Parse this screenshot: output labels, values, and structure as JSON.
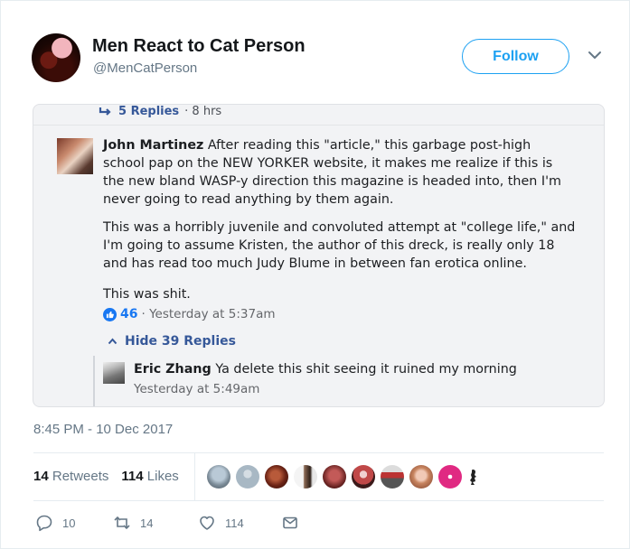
{
  "tweet": {
    "display_name": "Men React to Cat Person",
    "handle": "@MenCatPerson",
    "follow_label": "Follow",
    "timestamp": "8:45 PM - 10 Dec 2017"
  },
  "embedded": {
    "replies_count": "5 Replies",
    "replies_age": "· 8 hrs",
    "comment": {
      "author": "John Martinez",
      "paragraph1": "After reading this \"article,\" this garbage post-high school pap on the NEW YORKER website, it makes me realize if this is the new bland WASP-y direction this magazine is headed into, then I'm never going to read anything by them again.",
      "paragraph2": "This was a horribly juvenile and convoluted attempt at \"college life,\" and I'm going to assume Kristen, the author of this dreck, is really only 18 and has read too much Judy Blume in between fan erotica online.",
      "paragraph3": "This was shit.",
      "likes": "46",
      "time": "· Yesterday at 5:37am"
    },
    "hide_replies_label": "Hide 39 Replies",
    "reply": {
      "author": "Eric Zhang",
      "text": "Ya delete this shit seeing it ruined my morning",
      "time": "Yesterday at 5:49am"
    }
  },
  "stats": {
    "retweets_count": "14",
    "retweets_label": "Retweets",
    "likes_count": "114",
    "likes_label": "Likes"
  },
  "actions": {
    "reply_count": "10",
    "retweet_count": "14",
    "like_count": "114"
  },
  "colors": {
    "brand_blue": "#1da1f2",
    "facebook_link": "#365899",
    "muted": "#657786"
  }
}
